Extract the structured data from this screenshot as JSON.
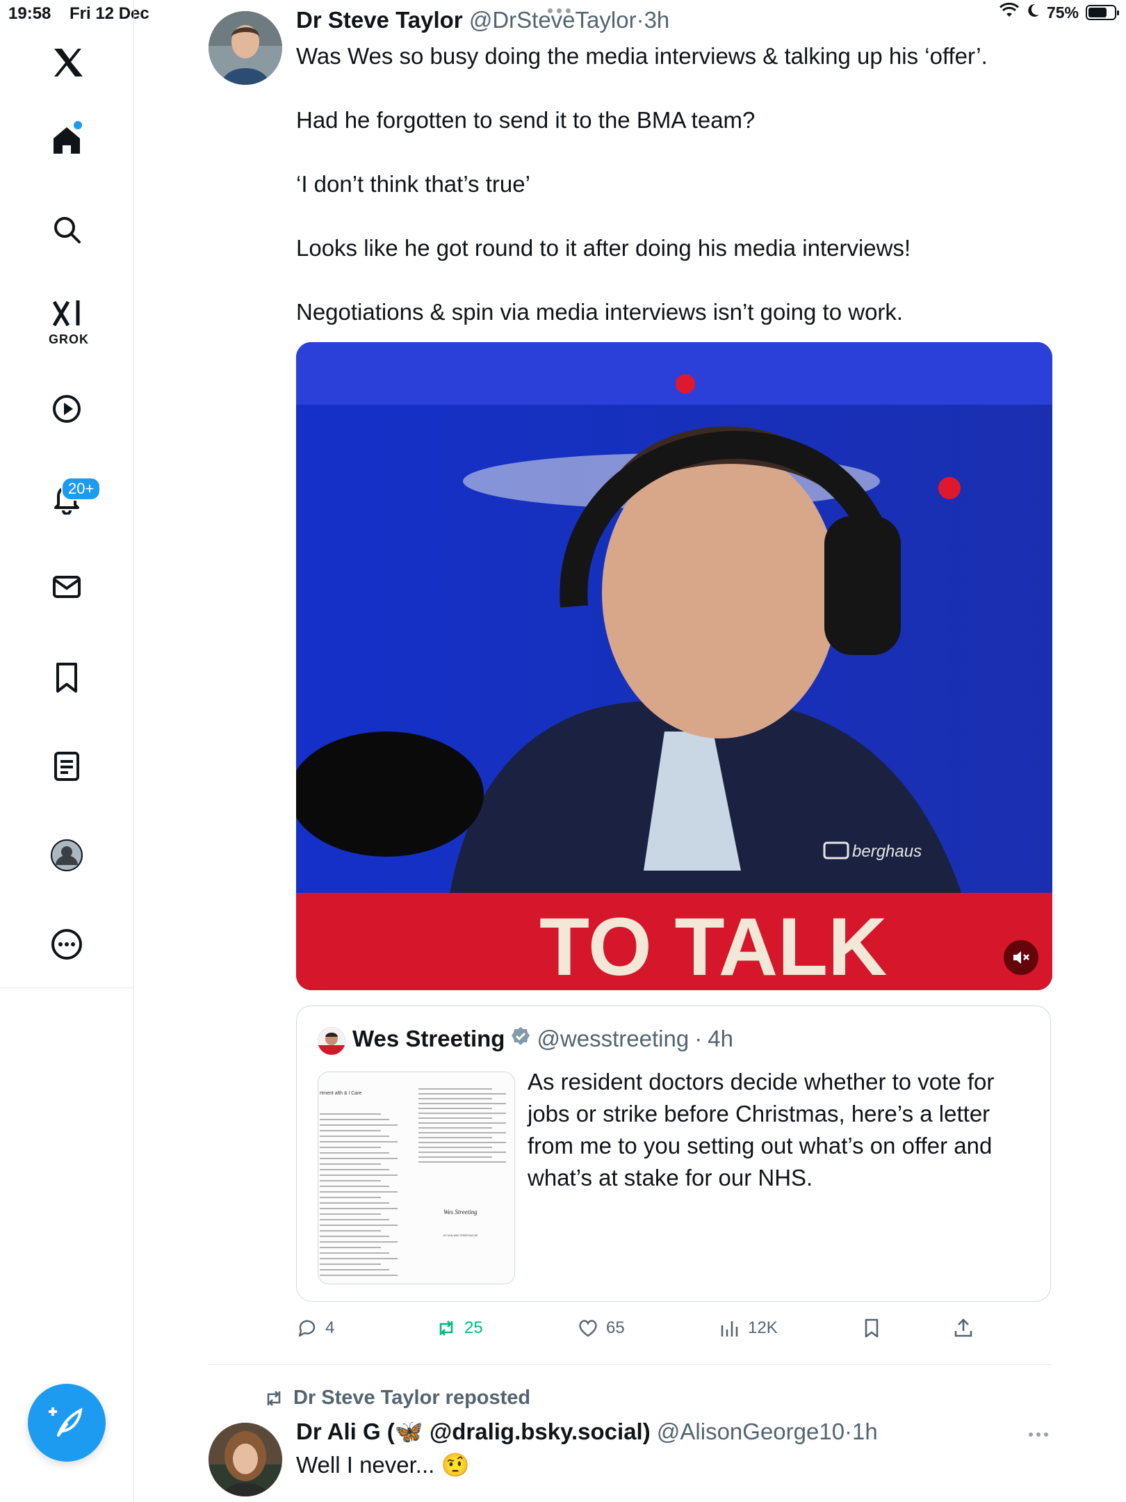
{
  "status": {
    "time": "19:58",
    "date": "Fri 12 Dec",
    "battery": "75%",
    "battery_level": 0.75
  },
  "sidebar": {
    "items": [
      {
        "name": "x-logo"
      },
      {
        "name": "home"
      },
      {
        "name": "search"
      },
      {
        "name": "grok",
        "label": "GROK"
      },
      {
        "name": "video"
      },
      {
        "name": "notifications",
        "badge": "20+"
      },
      {
        "name": "messages"
      },
      {
        "name": "bookmarks"
      },
      {
        "name": "lists"
      },
      {
        "name": "profile"
      },
      {
        "name": "more"
      }
    ]
  },
  "tweet": {
    "author_name": "Dr Steve Taylor",
    "handle": "@DrSteveTaylor",
    "time": "3h",
    "paragraphs": [
      "Was Wes so busy doing the media interviews & talking up his ‘offer’.",
      "Had he forgotten to send it to the BMA team?",
      "‘I don’t think that’s true’",
      "Looks like he got round to it after doing his media interviews!",
      "Negotiations & spin via media interviews isn’t going to work."
    ],
    "media_caption": "TO TALK",
    "media_brand": "berghaus",
    "quote": {
      "author_name": "Wes Streeting",
      "handle": "@wesstreeting",
      "time": "4h",
      "text": "As resident doctors decide whether to vote for jobs or strike before Christmas, here’s a letter from me to you setting out what’s on offer and what’s at stake for our NHS.",
      "letter_heading": "rtment\nalth &\nl Care",
      "letter_signature": "Wes Streeting",
      "letter_footer": "RT HON WES STREETING MP"
    },
    "actions": {
      "replies": "4",
      "reposts": "25",
      "likes": "65",
      "views": "12K"
    }
  },
  "next_tweet": {
    "repost_label": "Dr Steve Taylor reposted",
    "author_name": "Dr Ali G (🦋 @dralig.bsky.social)",
    "handle": "@AlisonGeorge10",
    "time": "1h",
    "text": "Well I never... 🤨"
  }
}
